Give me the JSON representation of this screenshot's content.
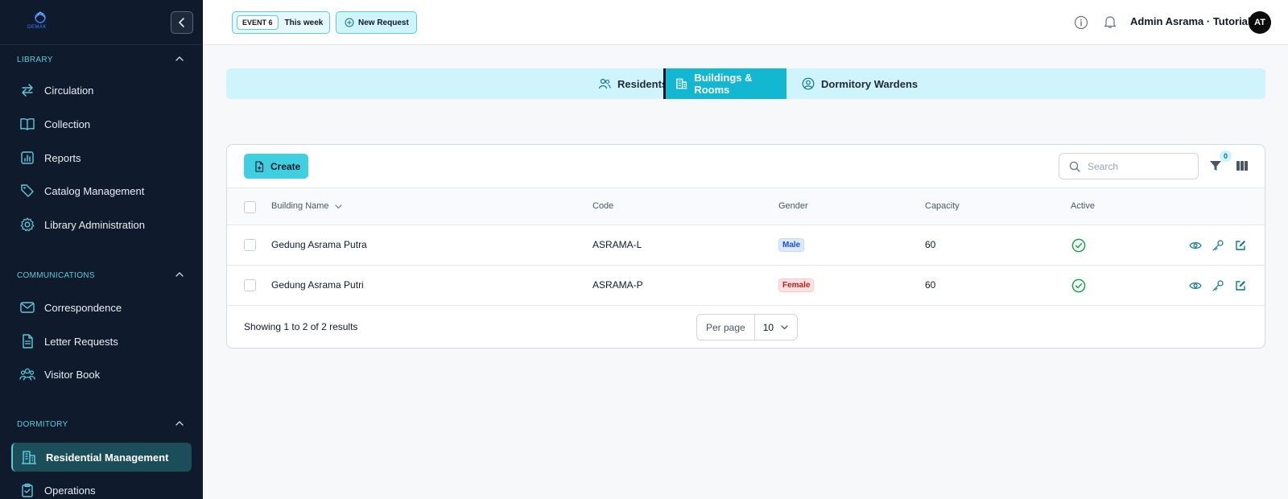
{
  "sidebar": {
    "logo_text": "DEMAK",
    "sections": [
      {
        "title": "LIBRARY",
        "items": [
          {
            "label": "Circulation",
            "icon": "arrows-swap-icon"
          },
          {
            "label": "Collection",
            "icon": "book-open-icon"
          },
          {
            "label": "Reports",
            "icon": "chart-bar-icon"
          },
          {
            "label": "Catalog Management",
            "icon": "tag-icon"
          },
          {
            "label": "Library Administration",
            "icon": "gear-icon"
          }
        ]
      },
      {
        "title": "COMMUNICATIONS",
        "items": [
          {
            "label": "Correspondence",
            "icon": "envelope-icon"
          },
          {
            "label": "Letter Requests",
            "icon": "document-icon"
          },
          {
            "label": "Visitor Book",
            "icon": "users-group-icon"
          }
        ]
      },
      {
        "title": "DORMITORY",
        "items": [
          {
            "label": "Residential Management",
            "icon": "building-icon",
            "active": true
          },
          {
            "label": "Operations",
            "icon": "clipboard-check-icon"
          }
        ]
      }
    ]
  },
  "header": {
    "event_tag": "EVENT 6",
    "event_period": "This week",
    "new_request_label": "New Request",
    "user_name": "Admin Asrama · Tutorial",
    "avatar_initials": "AT"
  },
  "tabs": [
    {
      "label": "Residents",
      "icon": "users-icon",
      "active": false
    },
    {
      "label": "Buildings & Rooms",
      "icon": "building-icon",
      "active": true
    },
    {
      "label": "Dormitory Wardens",
      "icon": "user-circle-icon",
      "active": false
    }
  ],
  "toolbar": {
    "create_label": "Create",
    "search_placeholder": "Search",
    "filter_count": "0"
  },
  "table": {
    "columns": [
      "Building Name",
      "Code",
      "Gender",
      "Capacity",
      "Active"
    ],
    "rows": [
      {
        "name": "Gedung Asrama Putra",
        "code": "ASRAMA-L",
        "gender": "Male",
        "capacity": "60",
        "active": true
      },
      {
        "name": "Gedung Asrama Putri",
        "code": "ASRAMA-P",
        "gender": "Female",
        "capacity": "60",
        "active": true
      }
    ]
  },
  "pagination": {
    "summary": "Showing 1 to 2 of 2 results",
    "per_page_label": "Per page",
    "per_page_value": "10"
  },
  "colors": {
    "sidebar_bg": "#0f1b2d",
    "accent": "#14b7d2",
    "active_check": "#16a34a",
    "action_icon": "#0e7490"
  }
}
